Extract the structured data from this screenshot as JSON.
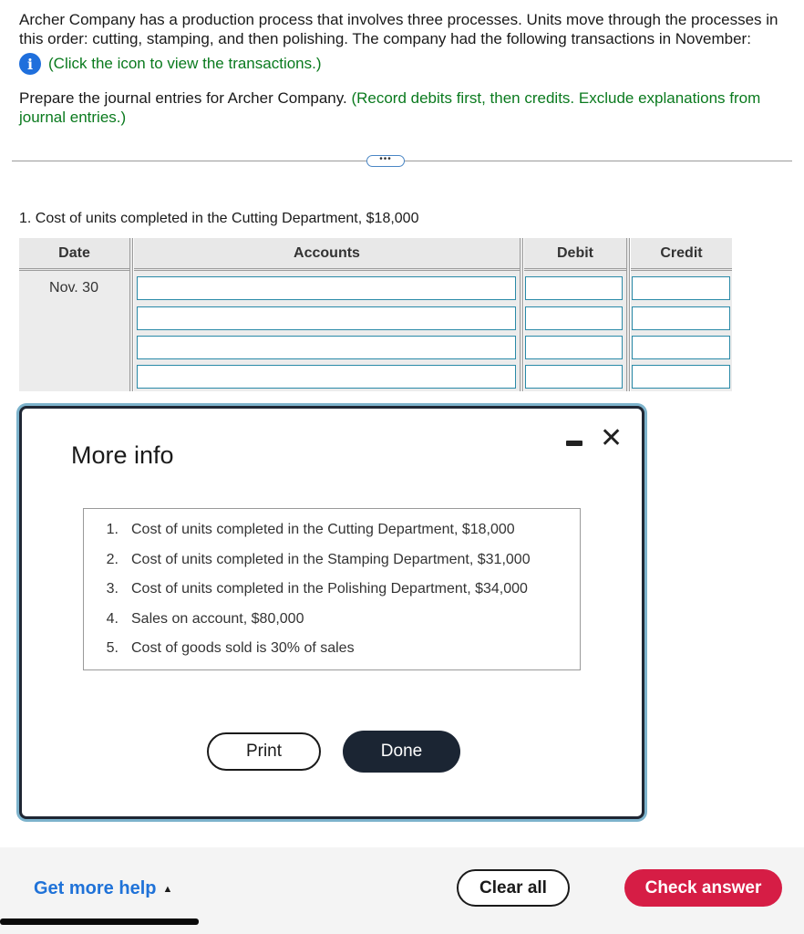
{
  "question": {
    "intro": "Archer Company has a production process that involves three processes. Units move through the processes in this order: cutting, stamping, and then polishing. The company had the following transactions in November:",
    "info_link": "(Click the icon to view the transactions.)",
    "prepare_text": "Prepare the journal entries for Archer Company.",
    "prepare_hint": "(Record debits first, then credits. Exclude explanations from journal entries.)",
    "divider_button": "•••"
  },
  "item": {
    "title": "1. Cost of units completed in the Cutting Department, $18,000"
  },
  "journal": {
    "headers": {
      "date": "Date",
      "accounts": "Accounts",
      "debit": "Debit",
      "credit": "Credit"
    },
    "date": "Nov. 30",
    "rows": [
      {
        "account": "",
        "debit": "",
        "credit": ""
      },
      {
        "account": "",
        "debit": "",
        "credit": ""
      },
      {
        "account": "",
        "debit": "",
        "credit": ""
      },
      {
        "account": "",
        "debit": "",
        "credit": ""
      }
    ]
  },
  "modal": {
    "title": "More info",
    "items": [
      {
        "num": "1.",
        "text": "Cost of units completed in the Cutting Department, $18,000"
      },
      {
        "num": "2.",
        "text": "Cost of units completed in the Stamping Department, $31,000"
      },
      {
        "num": "3.",
        "text": "Cost of units completed in the Polishing Department, $34,000"
      },
      {
        "num": "4.",
        "text": "Sales on account, $80,000"
      },
      {
        "num": "5.",
        "text": "Cost of goods sold is 30% of sales"
      }
    ],
    "print_label": "Print",
    "done_label": "Done",
    "close_glyph": "✕"
  },
  "footer": {
    "help_label": "Get more help",
    "help_caret": "▲",
    "clear_label": "Clear all",
    "check_label": "Check answer"
  },
  "colors": {
    "hint_green": "#0a7a1e",
    "info_blue": "#1f6fdc",
    "input_border": "#2a8aa8",
    "done_bg": "#1b2533",
    "check_bg": "#d61d45",
    "help_blue": "#1f72d8"
  },
  "icons": {
    "info": "info-icon",
    "minimize": "minimize-icon",
    "close": "close-icon",
    "caret": "caret-up-icon"
  }
}
